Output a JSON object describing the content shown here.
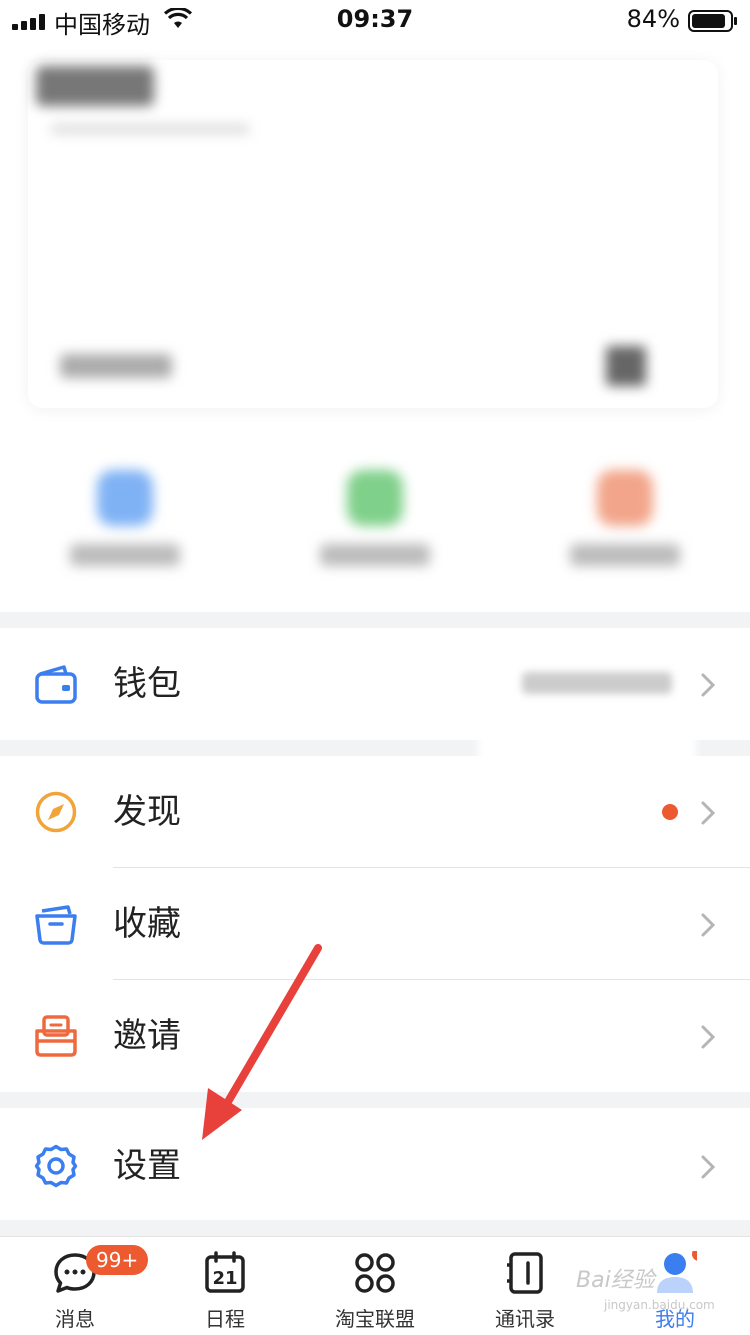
{
  "status_bar": {
    "carrier": "中国移动",
    "time": "09:37",
    "battery": "84%"
  },
  "menu": {
    "wallet": {
      "label": "钱包"
    },
    "discover": {
      "label": "发现"
    },
    "favorites": {
      "label": "收藏"
    },
    "invite": {
      "label": "邀请"
    },
    "settings": {
      "label": "设置"
    }
  },
  "tabbar": {
    "tabs": [
      {
        "label": "消息",
        "badge": "99+"
      },
      {
        "label": "日程",
        "date": "21"
      },
      {
        "label": "淘宝联盟"
      },
      {
        "label": "通讯录"
      },
      {
        "label": "我的"
      }
    ]
  },
  "watermark": {
    "text": "Bai经验",
    "sub": "jingyan.baidu.com"
  },
  "colors": {
    "accent_blue": "#3b7ef0",
    "discover_orange": "#f0a43a",
    "invite_red": "#ee6a3e",
    "badge_red": "#ee5a30",
    "arrow_red": "#e8403b"
  },
  "icons": {
    "wallet": "wallet-icon",
    "discover": "compass-icon",
    "favorites": "folder-icon",
    "invite": "gift-box-icon",
    "settings": "gear-icon",
    "chevron": "chevron-right-icon"
  }
}
